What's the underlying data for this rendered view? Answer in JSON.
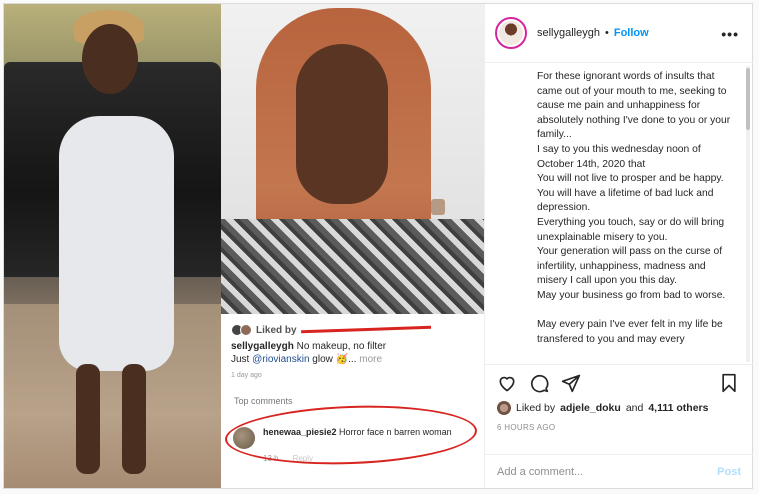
{
  "header": {
    "username": "sellygalleygh",
    "separator": "•",
    "follow_label": "Follow",
    "more_glyph": "•••"
  },
  "caption": {
    "text": "For these ignorant words of insults that came out of your mouth to me, seeking to cause me pain and unhappiness for absolutely nothing I've done to you or your family...\nI say to you this wednesday noon of October 14th, 2020 that\nYou will not live to prosper and be happy.\nYou will have a lifetime of bad luck and depression.\nEverything you touch, say or do will bring unexplainable misery to you.\nYour generation will pass on the curse of infertility, unhappiness, madness and misery I call upon you this day.\nMay your business go from bad to worse.\n\nMay every pain I've ever felt in my life be transfered to you and may every"
  },
  "screenshot": {
    "liked_by": "Liked by",
    "caption_user": "sellygalleygh",
    "caption_text": "No makeup, no filter",
    "caption_line2_prefix": "Just ",
    "caption_mention": "@riovianskin",
    "caption_line2_suffix": " glow 🥳...",
    "more": "more",
    "ago": "1 day ago",
    "top_comments": "Top comments",
    "comment_user": "henewaa_piesie2",
    "comment_text": " Horror face n barren woman",
    "comment_time": "13 h",
    "reply": "Reply"
  },
  "actions": {
    "liked_by_prefix": "Liked by",
    "liked_by_user": "adjele_doku",
    "and": "and",
    "others_count": "4,111 others",
    "time_ago": "6 HOURS AGO"
  },
  "comment_box": {
    "placeholder": "Add a comment...",
    "post_label": "Post"
  },
  "colors": {
    "accent": "#0095f6",
    "post_disabled": "#b2dffc",
    "annotation_red": "#d7241f"
  },
  "icons": [
    "heart-icon",
    "comment-icon",
    "share-icon",
    "bookmark-icon",
    "more-options-icon"
  ]
}
